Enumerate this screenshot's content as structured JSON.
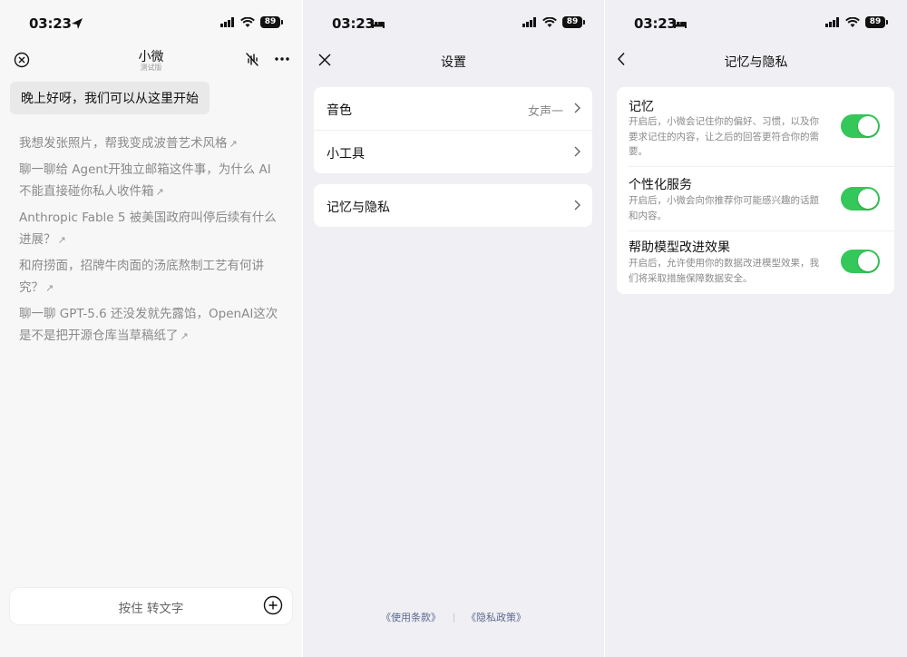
{
  "status_bar": {
    "time": "03:23",
    "battery": "89"
  },
  "chat_screen": {
    "title": "小微",
    "subtitle": "测试版",
    "greeting": "晚上好呀，我们可以从这里开始",
    "suggestions": [
      "我想发张照片，帮我变成波普艺术风格",
      "聊一聊给 Agent开独立邮箱这件事，为什么 AI 不能直接碰你私人收件箱",
      "Anthropic Fable 5 被美国政府叫停后续有什么进展？",
      "和府捞面，招牌牛肉面的汤底熬制工艺有何讲究？",
      "聊一聊 GPT-5.6 还没发就先露馅，OpenAI这次是不是把开源仓库当草稿纸了"
    ],
    "input_placeholder": "按住 转文字"
  },
  "settings_screen": {
    "title": "设置",
    "rows": [
      {
        "label": "音色",
        "value": "女声一"
      },
      {
        "label": "小工具",
        "value": ""
      },
      {
        "label": "记忆与隐私",
        "value": ""
      }
    ],
    "terms_link": "《使用条款》",
    "privacy_link": "《隐私政策》"
  },
  "privacy_screen": {
    "title": "记忆与隐私",
    "items": [
      {
        "title": "记忆",
        "description": "开启后，小微会记住你的偏好、习惯，以及你要求记住的内容，让之后的回答更符合你的需要。",
        "enabled": true
      },
      {
        "title": "个性化服务",
        "description": "开启后，小微会向你推荐你可能感兴趣的话题和内容。",
        "enabled": true
      },
      {
        "title": "帮助模型改进效果",
        "description": "开启后，允许使用你的数据改进模型效果，我们将采取措施保障数据安全。",
        "enabled": true
      }
    ]
  },
  "colors": {
    "toggle_on": "#34c759",
    "link": "#5b6a8f"
  },
  "icons": {
    "location": "location-arrow-icon",
    "sleep": "bed-icon",
    "signal": "signal-icon",
    "wifi": "wifi-icon",
    "close": "close-icon",
    "mute": "mute-icon",
    "more": "more-icon",
    "back": "back-chevron-icon",
    "chevron": "chevron-right-icon",
    "plus": "plus-circle-icon",
    "external": "external-arrow-icon"
  }
}
